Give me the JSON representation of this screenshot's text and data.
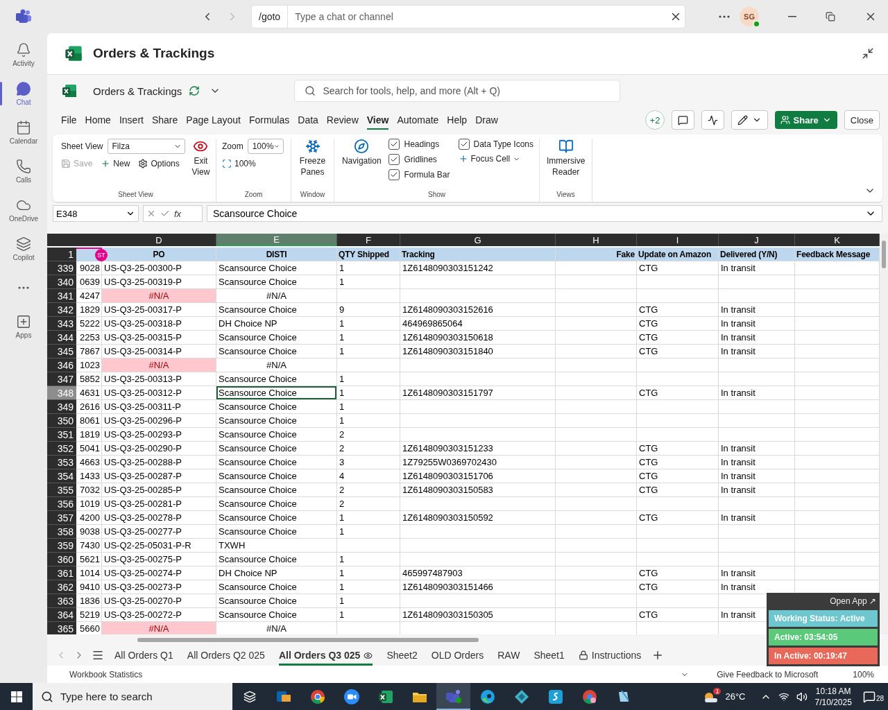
{
  "app_bar": {
    "search_prefix": "/goto",
    "search_placeholder": "Type a chat or channel",
    "avatar": "SG"
  },
  "rail": [
    {
      "label": "Activity",
      "kind": "bell",
      "selected": false
    },
    {
      "label": "Chat",
      "kind": "chat",
      "selected": true
    },
    {
      "label": "Calendar",
      "kind": "calendar",
      "selected": false
    },
    {
      "label": "Calls",
      "kind": "phone",
      "selected": false
    },
    {
      "label": "OneDrive",
      "kind": "cloud",
      "selected": false
    },
    {
      "label": "Copilot",
      "kind": "copilot",
      "selected": false
    },
    {
      "kind": "more",
      "selected": false
    },
    {
      "label": "Apps",
      "kind": "apps",
      "selected": false
    }
  ],
  "header": {
    "title": "Orders & Trackings"
  },
  "workbook": {
    "name": "Orders & Trackings",
    "search_placeholder": "Search for tools, help, and more (Alt + Q)"
  },
  "menu_tabs": [
    {
      "label": "File",
      "selected": false
    },
    {
      "label": "Home",
      "selected": false
    },
    {
      "label": "Insert",
      "selected": false
    },
    {
      "label": "Share",
      "selected": false
    },
    {
      "label": "Page Layout",
      "selected": false
    },
    {
      "label": "Formulas",
      "selected": false
    },
    {
      "label": "Data",
      "selected": false
    },
    {
      "label": "Review",
      "selected": false
    },
    {
      "label": "View",
      "selected": true
    },
    {
      "label": "Automate",
      "selected": false
    },
    {
      "label": "Help",
      "selected": false
    },
    {
      "label": "Draw",
      "selected": false
    }
  ],
  "collaborators": "+2",
  "share": "Share",
  "close": "Close",
  "ribbon": {
    "sheet_view": {
      "title": "Sheet View",
      "label": "Sheet View",
      "value": "Filza",
      "save": {
        "label": "Save",
        "disabled": true
      },
      "new": "New",
      "options": "Options",
      "exit": "Exit View"
    },
    "zoom": {
      "title": "Zoom",
      "label": "Zoom",
      "value": "100%",
      "reset": "100%"
    },
    "window": {
      "title": "Window",
      "freeze": "Freeze Panes"
    },
    "show": {
      "title": "Show",
      "navigation": "Navigation",
      "checks": [
        {
          "label": "Headings",
          "checked": true
        },
        {
          "label": "Gridlines",
          "checked": true
        },
        {
          "label": "Formula Bar",
          "checked": true
        },
        {
          "label": "Data Type Icons",
          "checked": true
        }
      ],
      "focus": "Focus Cell"
    },
    "views": {
      "title": "Views",
      "reader": "Immersive Reader"
    }
  },
  "formula_bar": {
    "name_box": "E348",
    "fx": "fx",
    "value": "Scansource Choice"
  },
  "columns": [
    {
      "letter": "D",
      "selected": false
    },
    {
      "letter": "E",
      "selected": true
    },
    {
      "letter": "F",
      "selected": false
    },
    {
      "letter": "G",
      "selected": false
    },
    {
      "letter": "H",
      "selected": false
    },
    {
      "letter": "I",
      "selected": false
    },
    {
      "letter": "J",
      "selected": false
    },
    {
      "letter": "K",
      "selected": false
    }
  ],
  "header_row": {
    "num": "1",
    "badge": "ST",
    "cells": [
      "PO",
      "DISTI",
      "QTY Shipped",
      "Tracking",
      "Fake",
      "Update on Amazon",
      "Delivered (Y/N)",
      "Feedback Message"
    ]
  },
  "rows": [
    {
      "num": "339",
      "c": "9028",
      "po": "US-Q3-25-00300-P",
      "disti": "Scansource Choice",
      "qty": "1",
      "tracking": "1Z6148090303151242",
      "amazon": "CTG",
      "delivered": "In transit",
      "error": false,
      "selected": false
    },
    {
      "num": "340",
      "c": "0639",
      "po": "US-Q3-25-00319-P",
      "disti": "Scansource Choice",
      "qty": "1",
      "error": false,
      "selected": false
    },
    {
      "num": "341",
      "c": "4247",
      "po": "#N/A",
      "disti": "#N/A",
      "error": true,
      "selected": false
    },
    {
      "num": "342",
      "c": "1829",
      "po": "US-Q3-25-00317-P",
      "disti": "Scansource Choice",
      "qty": "9",
      "tracking": "1Z6148090303152616",
      "amazon": "CTG",
      "delivered": "In transit",
      "error": false,
      "selected": false
    },
    {
      "num": "343",
      "c": "5222",
      "po": "US-Q3-25-00318-P",
      "disti": "DH Choice NP",
      "qty": "1",
      "tracking": "464969865064",
      "amazon": "CTG",
      "delivered": "In transit",
      "error": false,
      "selected": false
    },
    {
      "num": "344",
      "c": "2253",
      "po": "US-Q3-25-00315-P",
      "disti": "Scansource Choice",
      "qty": "1",
      "tracking": "1Z6148090303150618",
      "amazon": "CTG",
      "delivered": "In transit",
      "error": false,
      "selected": false
    },
    {
      "num": "345",
      "c": "7867",
      "po": "US-Q3-25-00314-P",
      "disti": "Scansource Choice",
      "qty": "1",
      "tracking": "1Z6148090303151840",
      "amazon": "CTG",
      "delivered": "In transit",
      "error": false,
      "selected": false
    },
    {
      "num": "346",
      "c": "1023",
      "po": "#N/A",
      "disti": "#N/A",
      "error": true,
      "selected": false
    },
    {
      "num": "347",
      "c": "5852",
      "po": "US-Q3-25-00313-P",
      "disti": "Scansource Choice",
      "qty": "1",
      "error": false,
      "selected": false
    },
    {
      "num": "348",
      "c": "4631",
      "po": "US-Q3-25-00312-P",
      "disti": "Scansource Choice",
      "qty": "1",
      "tracking": "1Z6148090303151797",
      "amazon": "CTG",
      "delivered": "In transit",
      "error": false,
      "selected": true
    },
    {
      "num": "349",
      "c": "2616",
      "po": "US-Q3-25-00311-P",
      "disti": "Scansource Choice",
      "qty": "1",
      "error": false,
      "selected": false
    },
    {
      "num": "350",
      "c": "8061",
      "po": "US-Q3-25-00296-P",
      "disti": "Scansource Choice",
      "qty": "1",
      "error": false,
      "selected": false
    },
    {
      "num": "351",
      "c": "1819",
      "po": "US-Q3-25-00293-P",
      "disti": "Scansource Choice",
      "qty": "2",
      "error": false,
      "selected": false
    },
    {
      "num": "352",
      "c": "5041",
      "po": "US-Q3-25-00290-P",
      "disti": "Scansource Choice",
      "qty": "2",
      "tracking": "1Z6148090303151233",
      "amazon": "CTG",
      "delivered": "In transit",
      "error": false,
      "selected": false
    },
    {
      "num": "353",
      "c": "4663",
      "po": "US-Q3-25-00288-P",
      "disti": "Scansource Choice",
      "qty": "3",
      "tracking": "1Z79255W0369702430",
      "amazon": "CTG",
      "delivered": "In transit",
      "error": false,
      "selected": false
    },
    {
      "num": "354",
      "c": "1433",
      "po": "US-Q3-25-00287-P",
      "disti": "Scansource Choice",
      "qty": "4",
      "tracking": "1Z6148090303151706",
      "amazon": "CTG",
      "delivered": "In transit",
      "error": false,
      "selected": false
    },
    {
      "num": "355",
      "c": "7032",
      "po": "US-Q3-25-00285-P",
      "disti": "Scansource Choice",
      "qty": "2",
      "tracking": "1Z6148090303150583",
      "amazon": "CTG",
      "delivered": "In transit",
      "error": false,
      "selected": false
    },
    {
      "num": "356",
      "c": "1019",
      "po": "US-Q3-25-00281-P",
      "disti": "Scansource Choice",
      "qty": "2",
      "error": false,
      "selected": false
    },
    {
      "num": "357",
      "c": "4200",
      "po": "US-Q3-25-00278-P",
      "disti": "Scansource Choice",
      "qty": "1",
      "tracking": "1Z6148090303150592",
      "amazon": "CTG",
      "delivered": "In transit",
      "error": false,
      "selected": false
    },
    {
      "num": "358",
      "c": "9038",
      "po": "US-Q3-25-00277-P",
      "disti": "Scansource Choice",
      "qty": "1",
      "error": false,
      "selected": false
    },
    {
      "num": "359",
      "c": "7430",
      "po": "US-Q2-25-05031-P-R",
      "disti": "TXWH",
      "error": false,
      "selected": false
    },
    {
      "num": "360",
      "c": "5621",
      "po": "US-Q3-25-00275-P",
      "disti": "Scansource Choice",
      "qty": "1",
      "error": false,
      "selected": false
    },
    {
      "num": "361",
      "c": "1014",
      "po": "US-Q3-25-00274-P",
      "disti": "DH Choice NP",
      "qty": "1",
      "tracking": "465997487903",
      "amazon": "CTG",
      "delivered": "In transit",
      "error": false,
      "selected": false
    },
    {
      "num": "362",
      "c": "9410",
      "po": "US-Q3-25-00273-P",
      "disti": "Scansource Choice",
      "qty": "1",
      "tracking": "1Z6148090303151466",
      "amazon": "CTG",
      "delivered": "In transit",
      "error": false,
      "selected": false
    },
    {
      "num": "363",
      "c": "1836",
      "po": "US-Q3-25-00270-P",
      "disti": "Scansource Choice",
      "qty": "1",
      "error": false,
      "selected": false
    },
    {
      "num": "364",
      "c": "5219",
      "po": "US-Q3-25-00272-P",
      "disti": "Scansource Choice",
      "qty": "1",
      "tracking": "1Z6148090303150305",
      "amazon": "CTG",
      "delivered": "In transit",
      "error": false,
      "selected": false
    },
    {
      "num": "365",
      "c": "5660",
      "po": "#N/A",
      "disti": "#N/A",
      "error": true,
      "selected": false
    }
  ],
  "sheet_tabs": [
    {
      "label": "All Orders Q1",
      "selected": false,
      "kind": "plain"
    },
    {
      "label": "All Orders Q2 025",
      "selected": false,
      "kind": "plain"
    },
    {
      "label": "All Orders Q3 025",
      "selected": true,
      "kind": "watched"
    },
    {
      "label": "Sheet2",
      "selected": false,
      "kind": "plain"
    },
    {
      "label": "OLD Orders",
      "selected": false,
      "kind": "plain"
    },
    {
      "label": "RAW",
      "selected": false,
      "kind": "plain"
    },
    {
      "label": "Sheet1",
      "selected": false,
      "kind": "plain"
    },
    {
      "label": "Instructions",
      "selected": false,
      "kind": "locked"
    }
  ],
  "status_bar": {
    "stats": "Workbook Statistics",
    "feedback": "Give Feedback to Microsoft",
    "zoom": "100%"
  },
  "tracker": {
    "open": "Open App ↗",
    "items": [
      {
        "text": "Working Status: Active",
        "color": "#6ec6cf"
      },
      {
        "text": "Active: 03:54:05",
        "color": "#5bc97a"
      },
      {
        "text": "In Active: 00:19:47",
        "color": "#e8685a"
      }
    ]
  },
  "taskbar": {
    "search": "Type here to search",
    "weather_badge": "1",
    "temperature": "26°C",
    "time": "10:18 AM",
    "date": "7/10/2025",
    "notifications": "28"
  }
}
